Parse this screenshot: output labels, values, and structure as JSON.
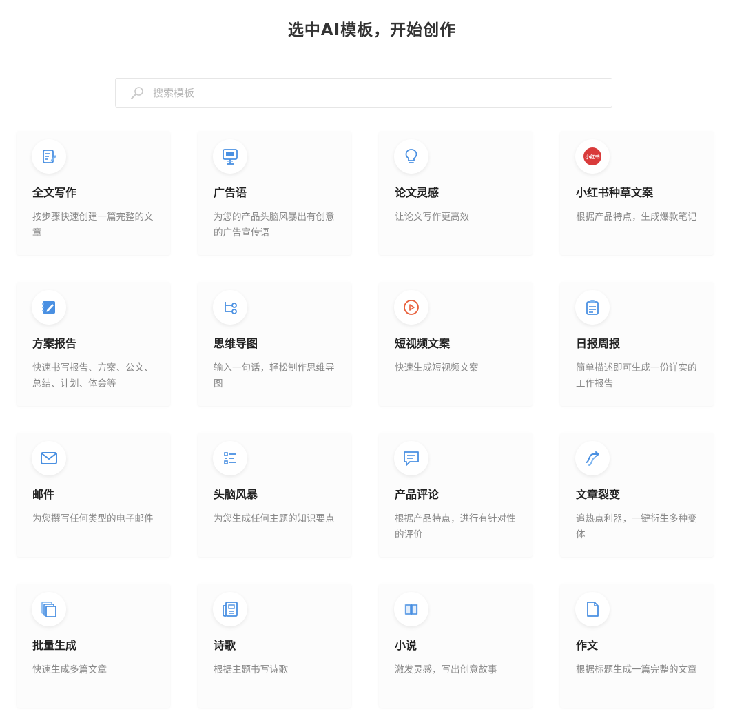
{
  "header": {
    "title": "选中AI模板，开始创作"
  },
  "search": {
    "placeholder": "搜索模板"
  },
  "templates": [
    {
      "title": "全文写作",
      "desc": "按步骤快速创建一篇完整的文章",
      "icon": "document-edit-icon"
    },
    {
      "title": "广告语",
      "desc": "为您的产品头脑风暴出有创意的广告宣传语",
      "icon": "ad-board-icon"
    },
    {
      "title": "论文灵感",
      "desc": "让论文写作更高效",
      "icon": "lightbulb-icon"
    },
    {
      "title": "小红书种草文案",
      "desc": "根据产品特点，生成爆款笔记",
      "icon": "xiaohongshu-logo-icon",
      "logo_text": "小红书"
    },
    {
      "title": "方案报告",
      "desc": "快速书写报告、方案、公文、总结、计划、体会等",
      "icon": "notebook-pen-icon"
    },
    {
      "title": "思维导图",
      "desc": "输入一句话，轻松制作思维导图",
      "icon": "mindmap-icon"
    },
    {
      "title": "短视频文案",
      "desc": "快速生成短视频文案",
      "icon": "play-circle-icon"
    },
    {
      "title": "日报周报",
      "desc": "简单描述即可生成一份详实的工作报告",
      "icon": "clipboard-icon"
    },
    {
      "title": "邮件",
      "desc": "为您撰写任何类型的电子邮件",
      "icon": "mail-icon"
    },
    {
      "title": "头脑风暴",
      "desc": "为您生成任何主题的知识要点",
      "icon": "list-icon"
    },
    {
      "title": "产品评论",
      "desc": "根据产品特点，进行有针对性的评价",
      "icon": "comment-icon"
    },
    {
      "title": "文章裂变",
      "desc": "追热点利器，一键衍生多种变体",
      "icon": "split-arrow-icon"
    },
    {
      "title": "批量生成",
      "desc": "快速生成多篇文章",
      "icon": "copy-stack-icon"
    },
    {
      "title": "诗歌",
      "desc": "根据主题书写诗歌",
      "icon": "newspaper-icon"
    },
    {
      "title": "小说",
      "desc": "激发灵感，写出创意故事",
      "icon": "open-book-icon"
    },
    {
      "title": "作文",
      "desc": "根据标题生成一篇完整的文章",
      "icon": "file-icon"
    }
  ],
  "colors": {
    "accent": "#4a90e2",
    "accent_light": "#7cb4f0",
    "xiaohongshu_red": "#d93b3b",
    "video_orange": "#e8603c"
  }
}
